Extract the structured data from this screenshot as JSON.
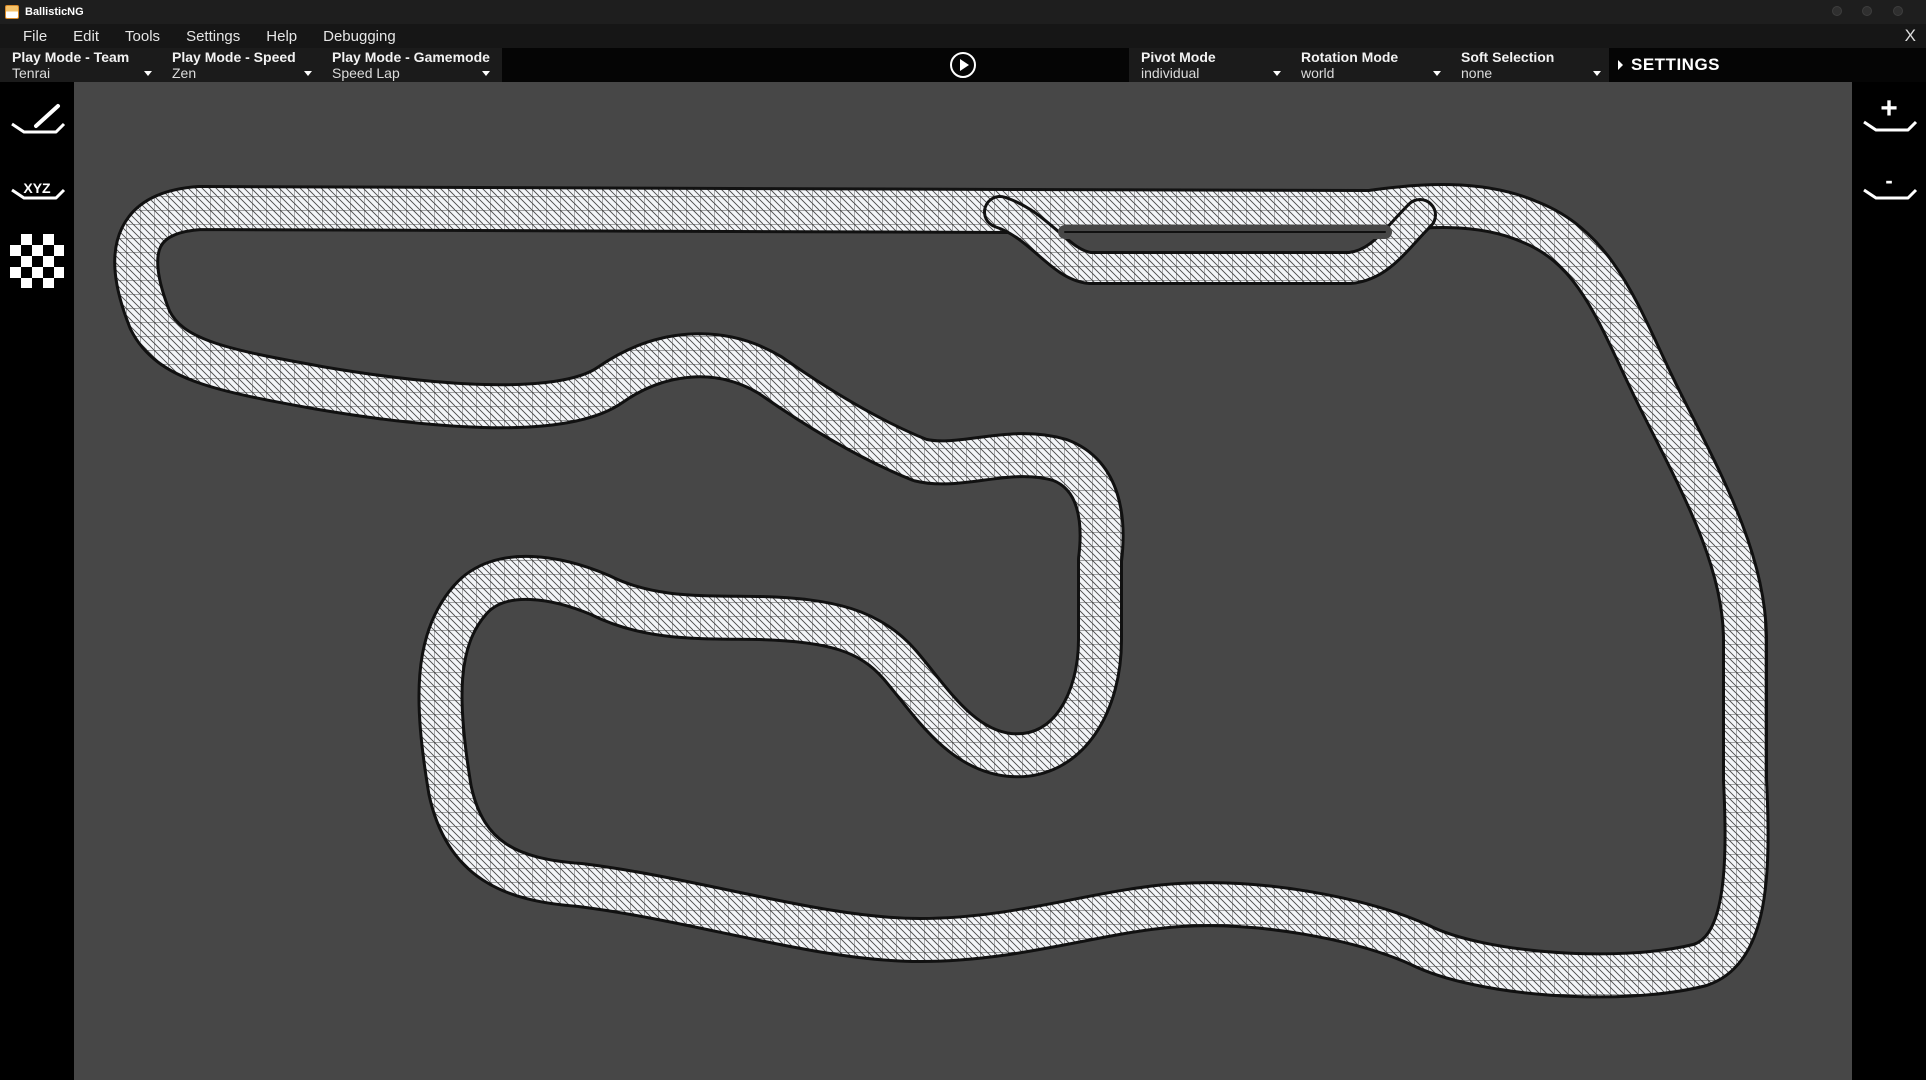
{
  "window": {
    "title": "BallisticNG"
  },
  "menu": {
    "items": [
      {
        "name": "menu-file",
        "label": "File"
      },
      {
        "name": "menu-edit",
        "label": "Edit"
      },
      {
        "name": "menu-tools",
        "label": "Tools"
      },
      {
        "name": "menu-settings",
        "label": "Settings"
      },
      {
        "name": "menu-help",
        "label": "Help"
      },
      {
        "name": "menu-debugging",
        "label": "Debugging"
      }
    ],
    "close_label": "X"
  },
  "toolbar": {
    "play_mode_team": {
      "label": "Play Mode - Team",
      "value": "Tenrai"
    },
    "play_mode_speed": {
      "label": "Play Mode - Speed",
      "value": "Zen"
    },
    "play_mode_gamemode": {
      "label": "Play Mode - Gamemode",
      "value": "Speed Lap"
    },
    "pivot_mode": {
      "label": "Pivot Mode",
      "value": "individual"
    },
    "rotation_mode": {
      "label": "Rotation Mode",
      "value": "world"
    },
    "soft_selection": {
      "label": "Soft Selection",
      "value": "none"
    },
    "settings_label": "SETTINGS"
  },
  "left_tools": {
    "xyz_label": "XYZ"
  },
  "right_tools": {
    "plus_label": "+",
    "minus_label": "-"
  },
  "colors": {
    "viewport_bg": "#474747",
    "track_fill": "#f4f6f8",
    "track_edge": "#1a1a1a",
    "panel_bg": "#000000",
    "dropdown_bg": "#1b1b1b"
  }
}
